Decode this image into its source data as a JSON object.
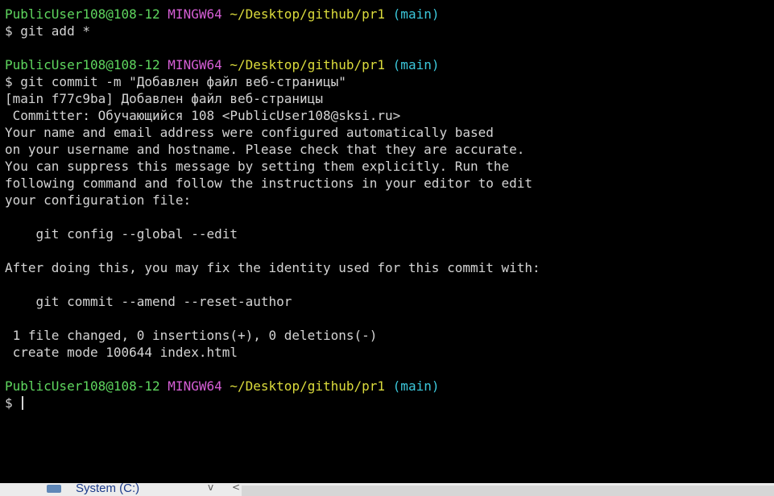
{
  "prompt": {
    "user": "PublicUser108@108-12",
    "host": "MINGW64",
    "path": "~/Desktop/github/pr1",
    "branch": "(main)"
  },
  "commands": {
    "add": "$ git add *",
    "commit": "$ git commit -m \"Добавлен файл веб-страницы\"",
    "current": "$ "
  },
  "output": {
    "commit_header": "[main f77c9ba] Добавлен файл веб-страницы",
    "committer": " Committer: Обучающийся 108 <PublicUser108@sksi.ru>",
    "msg1": "Your name and email address were configured automatically based",
    "msg2": "on your username and hostname. Please check that they are accurate.",
    "msg3": "You can suppress this message by setting them explicitly. Run the",
    "msg4": "following command and follow the instructions in your editor to edit",
    "msg5": "your configuration file:",
    "cmd_config": "    git config --global --edit",
    "msg6": "After doing this, you may fix the identity used for this commit with:",
    "cmd_amend": "    git commit --amend --reset-author",
    "stats": " 1 file changed, 0 insertions(+), 0 deletions(-)",
    "create": " create mode 100644 index.html"
  },
  "taskbar": {
    "drive_label": "System (C:)",
    "chevron": "v",
    "scroll_arrow": "<",
    "drive_icon": "drive-icon"
  },
  "colors": {
    "background": "#000000",
    "text": "#d4d4d4",
    "user": "#5fd75f",
    "host": "#d75fd7",
    "path": "#dcdc3c",
    "branch": "#3cc8dc"
  }
}
